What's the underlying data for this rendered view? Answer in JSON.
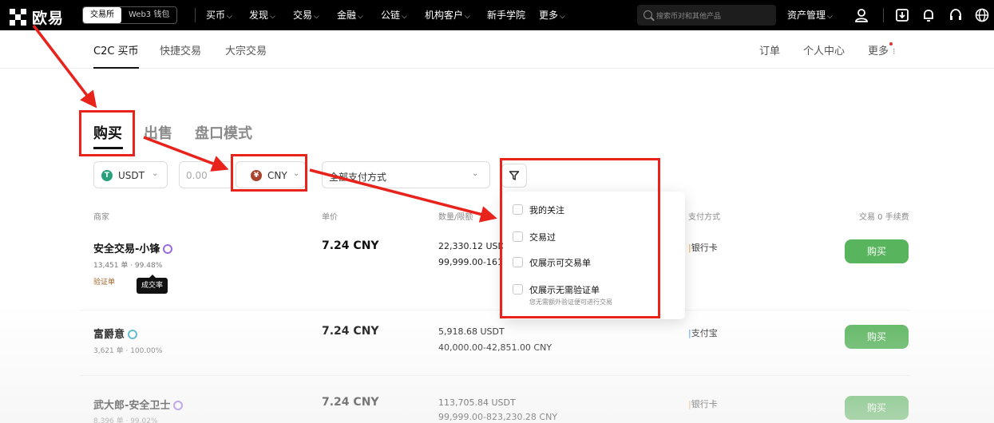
{
  "topnav": {
    "logo_text": "欧易",
    "switcher": [
      "交易所",
      "Web3 钱包"
    ],
    "items": [
      "买币",
      "发现",
      "交易",
      "金融",
      "公链",
      "机构客户",
      "新手学院",
      "更多"
    ],
    "search_placeholder": "搜索币对和其他产品",
    "asset_mgmt": "资产管理"
  },
  "subnav": {
    "tabs": [
      "C2C 买币",
      "快捷交易",
      "大宗交易"
    ],
    "right": [
      "订单",
      "个人中心",
      "更多"
    ]
  },
  "main_tabs": [
    "购买",
    "出售",
    "盘口模式"
  ],
  "filters": {
    "crypto": "USDT",
    "amount_placeholder": "0.00",
    "fiat": "CNY",
    "payment": "全部支付方式",
    "fiat_coin_glyph": "¥",
    "crypto_coin_glyph": "T"
  },
  "table": {
    "headers": [
      "商家",
      "单价",
      "数量/限额",
      "支付方式",
      "交易 0 手续费"
    ],
    "rows": [
      {
        "merchant": "安全交易-小锋",
        "stats": "13,451 单 · 99.48%",
        "price": "7.24 CNY",
        "amount": "22,330.12 USDT",
        "limit": "99,999.00-161",
        "payment": "银行卡",
        "action": "购买",
        "badge_color": "#9b6ae0"
      },
      {
        "merchant": "富爵意",
        "stats": "3,621 单 · 100.00%",
        "price": "7.24 CNY",
        "amount": "5,918.68 USDT",
        "limit": "40,000.00-42,851.00 CNY",
        "payment": "支付宝",
        "action": "购买",
        "badge_color": "#4fb3c9"
      },
      {
        "merchant": "武大郎-安全卫士",
        "stats": "8,396 单 · 99.02%",
        "price": "7.24 CNY",
        "amount": "113,705.84 USDT",
        "limit": "99,999.00-823,230.28 CNY",
        "payment": "银行卡",
        "action": "购买",
        "badge_color": "#9b6ae0"
      }
    ],
    "verify_label": "验证单",
    "tooltip": "成交率"
  },
  "dropdown": {
    "options": [
      "我的关注",
      "交易过",
      "仅展示可交易单",
      "仅展示无需验证单"
    ],
    "sub_note": "您无需额外验证便可进行交易"
  },
  "colors": {
    "accent_green": "#4caf50",
    "annotation_red": "#e8231c",
    "usdt_green": "#26a17b",
    "cny_red": "#a8452c"
  }
}
